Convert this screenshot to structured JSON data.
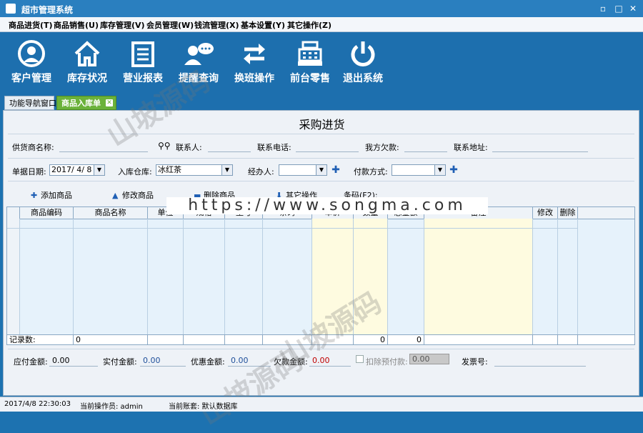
{
  "window": {
    "title": "超市管理系统",
    "minimize": "▫",
    "maximize": "□",
    "close": "✕"
  },
  "menu": [
    {
      "label": "商品进货(T)"
    },
    {
      "label": "商品销售(U)"
    },
    {
      "label": "库存管理(V)"
    },
    {
      "label": "会员管理(W)"
    },
    {
      "label": "钱流管理(X)"
    },
    {
      "label": "基本设置(Y)"
    },
    {
      "label": "其它操作(Z)"
    }
  ],
  "toolbar": [
    {
      "label": "客户管理",
      "icon": "customer-icon"
    },
    {
      "label": "库存状况",
      "icon": "home-icon"
    },
    {
      "label": "营业报表",
      "icon": "report-icon"
    },
    {
      "label": "提醒查询",
      "icon": "chat-icon"
    },
    {
      "label": "换班操作",
      "icon": "swap-icon"
    },
    {
      "label": "前台零售",
      "icon": "cash-register-icon"
    },
    {
      "label": "退出系统",
      "icon": "power-icon"
    }
  ],
  "tabs": [
    {
      "label": "功能导航窗口"
    },
    {
      "label": "商品入库单",
      "close": "✕"
    }
  ],
  "form": {
    "title": "采购进货",
    "supplier_label": "供货商名称:",
    "contact_label": "联系人:",
    "phone_label": "联系电话:",
    "debt_label": "我方欠款:",
    "address_label": "联系地址:",
    "date_label": "单据日期:",
    "date_value": "2017/ 4/ 8",
    "warehouse_label": "入库仓库:",
    "warehouse_value": "冰红茶",
    "handler_label": "经办人:",
    "payment_label": "付款方式:"
  },
  "actions": [
    {
      "label": "添加商品"
    },
    {
      "label": "修改商品"
    },
    {
      "label": "删除商品"
    },
    {
      "label": "其它操作"
    },
    {
      "label": "条码(F2):"
    }
  ],
  "table": {
    "columns": [
      "商品编码",
      "商品名称",
      "单位",
      "规格",
      "型号",
      "条码",
      "单价",
      "数量",
      "总金额",
      "备注",
      "修改",
      "删除"
    ],
    "footer_label": "记录数:",
    "record_count": "0",
    "qty_total": "0",
    "amount_total": "0"
  },
  "totals": {
    "payable_label": "应付金额:",
    "payable_value": "0.00",
    "paid_label": "实付金额:",
    "paid_value": "0.00",
    "discount_label": "优惠金额:",
    "discount_value": "0.00",
    "owed_label": "欠款金额:",
    "owed_value": "0.00",
    "deduct_label": "扣除预付款:",
    "deduct_value": "0.00",
    "invoice_label": "发票号:"
  },
  "status": {
    "datetime": "2017/4/8 22:30:03",
    "operator": "当前操作员: admin",
    "account": "当前账套: 默认数据库"
  },
  "watermark": {
    "cn": "山坡源码",
    "url": "https://www.songma.com"
  },
  "colors": {
    "toolbar": "#1d6fae",
    "active_tab": "#6bb23a",
    "owed_value": "#c00000"
  }
}
